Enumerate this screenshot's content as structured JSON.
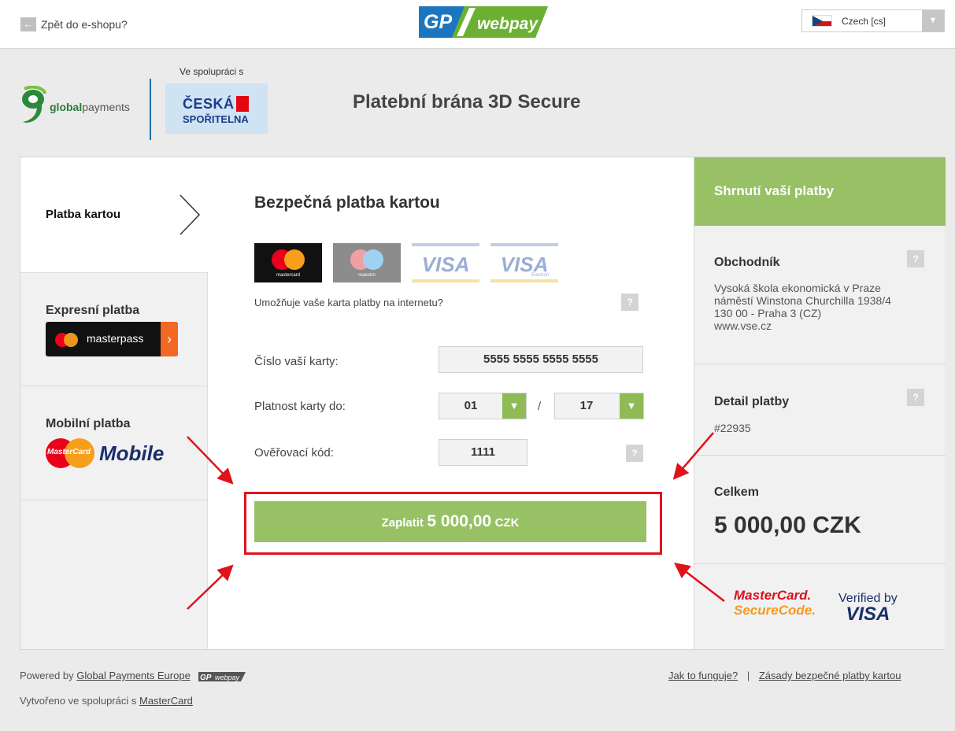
{
  "topbar": {
    "back_label": "Zpět do e-shopu?",
    "back_icon": "arrow-left-icon",
    "logo_gp": "GP",
    "logo_webpay": "webpay",
    "language": "Czech [cs]"
  },
  "header": {
    "global_payments_bold": "global",
    "global_payments_rest": "payments",
    "partnership_label": "Ve spolupráci s",
    "bank_line1": "ČESKÁ",
    "bank_line2": "SPOŘITELNA",
    "title": "Platební brána 3D Secure"
  },
  "tabs": {
    "card": "Platba kartou",
    "express": "Expresní platba",
    "masterpass": "masterpass",
    "mobile": "Mobilní platba",
    "mastercard_small": "MasterCard",
    "mobile_text": "Mobile"
  },
  "form": {
    "title": "Bezpečná platba kartou",
    "card_logos": {
      "mastercard": "mastercard",
      "maestro": "maestro",
      "visa": "VISA",
      "visa_electron": "VISA",
      "electron": "Electron"
    },
    "card_question": "Umožňuje vaše karta platby na internetu?",
    "card_number_label": "Číslo vaší karty:",
    "card_number_value": "5555 5555 5555 5555",
    "expiry_label": "Platnost karty do:",
    "expiry_month": "01",
    "expiry_separator": "/",
    "expiry_year": "17",
    "cvc_label": "Ověřovací kód:",
    "cvc_value": "1111",
    "help": "?",
    "pay_prefix": "Zaplatit",
    "pay_amount": "5 000,00",
    "pay_currency": "CZK"
  },
  "summary": {
    "title": "Shrnutí vaší platby",
    "merchant_heading": "Obchodník",
    "merchant_name": "Vysoká škola ekonomická v Praze",
    "merchant_street": "náměstí Winstona Churchilla 1938/4",
    "merchant_city": "130 00 - Praha 3 (CZ)",
    "merchant_web": "www.vse.cz",
    "detail_heading": "Detail platby",
    "detail_id": "#22935",
    "total_heading": "Celkem",
    "total_value": "5 000,00 CZK",
    "securecode_line1": "MasterCard.",
    "securecode_line2": "SecureCode.",
    "vbv_line1": "Verified by",
    "vbv_line2": "VISA"
  },
  "footer": {
    "powered_by": "Powered by",
    "powered_link": "Global Payments Europe",
    "created_with": "Vytvořeno ve spolupráci s",
    "created_link": "MasterCard",
    "how_link": "Jak to funguje?",
    "separator": "|",
    "security_link": "Zásady bezpečné platby kartou"
  },
  "colors": {
    "accent_green": "#97c164",
    "highlight_red": "#e0131a"
  }
}
